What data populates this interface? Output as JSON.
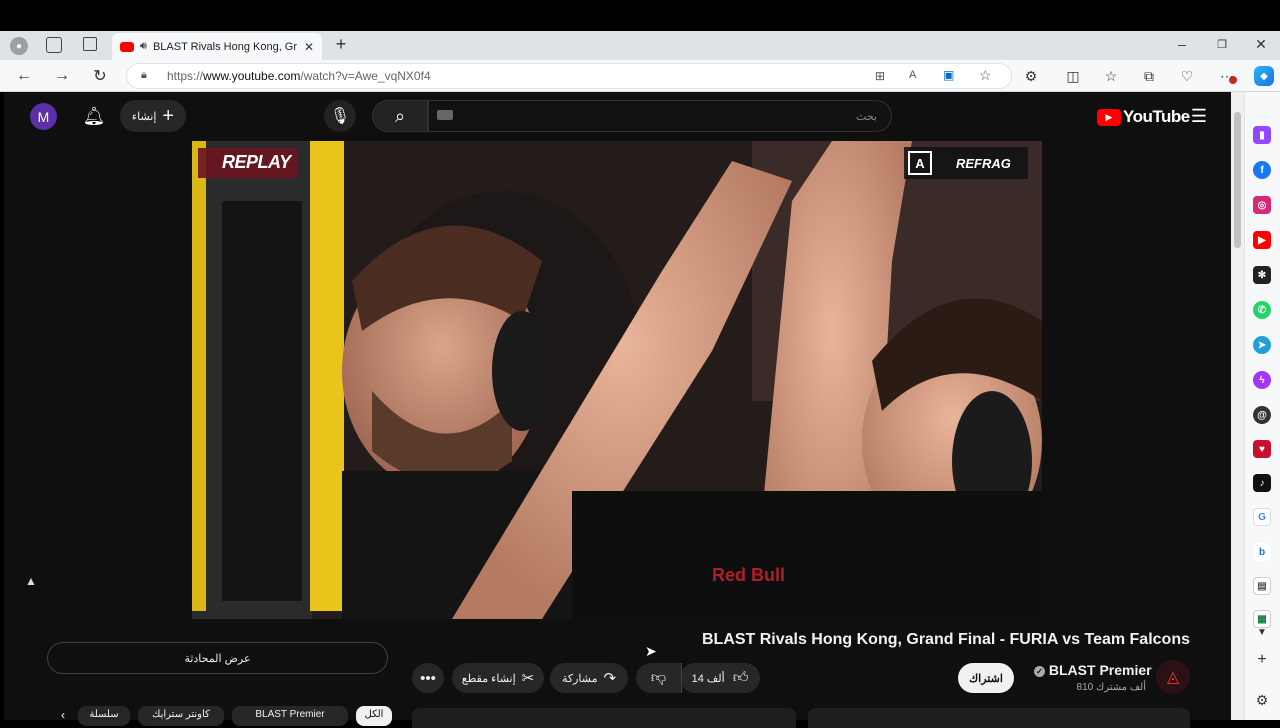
{
  "browser": {
    "tab_title": "BLAST Rivals Hong Kong, Gr",
    "url_prefix": "https://",
    "url_domain": "www.youtube.com",
    "url_path": "/watch?v=Awe_vqNX0f4"
  },
  "youtube": {
    "logo_text": "YouTube",
    "search_placeholder": "بحث",
    "create_label": "إنشاء",
    "avatar_letter": "M"
  },
  "video": {
    "replay_label": "REPLAY",
    "refrag_label": "REFRAG",
    "title": "BLAST Rivals Hong Kong, Grand Final - FURIA vs Team Falcons"
  },
  "channel": {
    "name": "BLAST Premier",
    "subscribers": "810 ألف مشترك",
    "subscribe_label": "اشتراك"
  },
  "actions": {
    "likes": "14 ألف",
    "share_label": "مشاركة",
    "clip_label": "إنشاء مقطع",
    "chat_label": "عرض المحادثة"
  },
  "chips": [
    "الكل",
    "BLAST Premier",
    "كاونتر سترايك",
    "سلسلة"
  ],
  "colors": {
    "yt_red": "#ff0000",
    "page_bg": "#0f0f0f",
    "avatar": "#5b2fa6"
  }
}
